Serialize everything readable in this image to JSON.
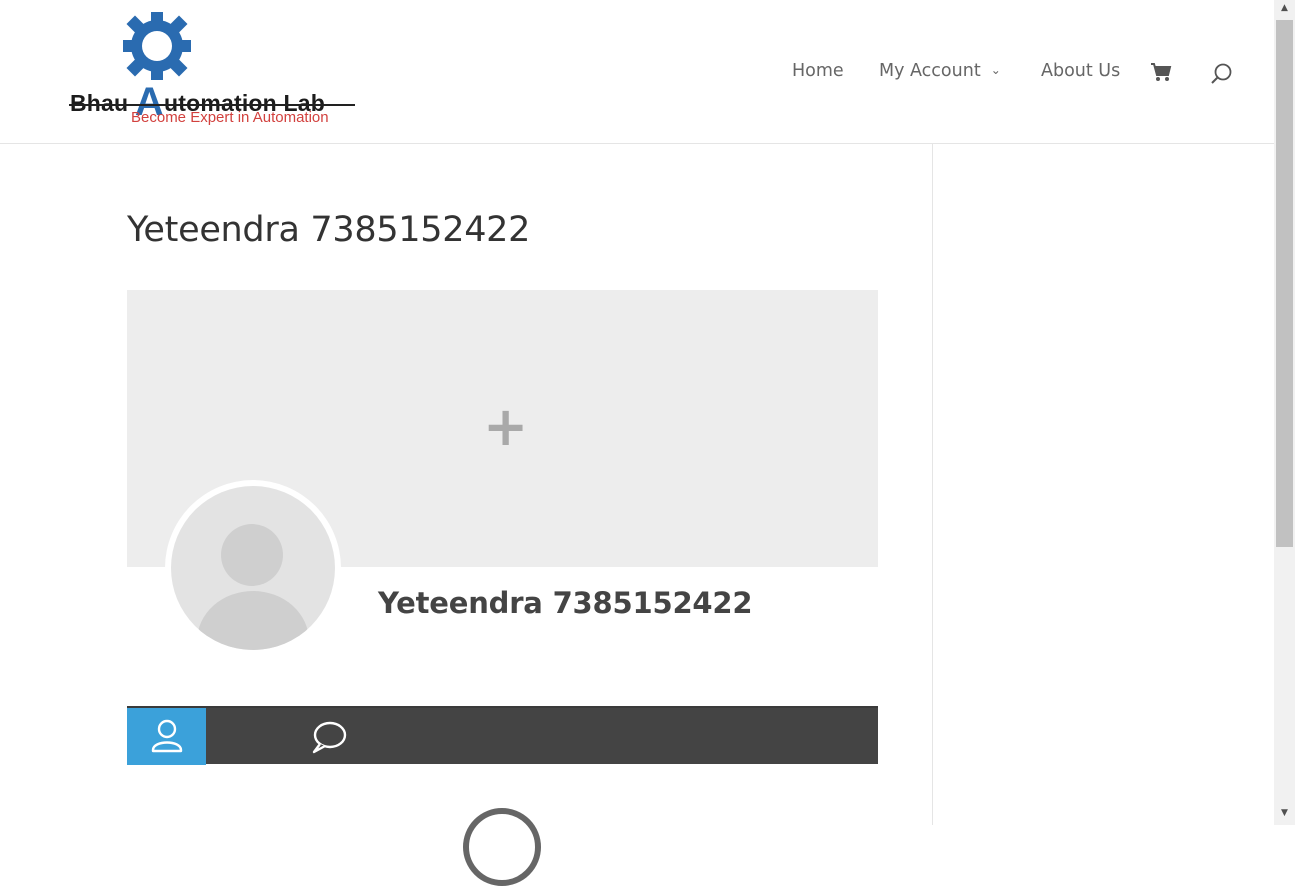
{
  "brand": {
    "name_prefix": "Bhau ",
    "name_a": "A",
    "name_suffix": "utomation Lab",
    "tagline": "Become Expert in Automation",
    "colors": {
      "gear": "#2a6bb0",
      "tagline": "#d2413e"
    }
  },
  "nav": {
    "items": [
      {
        "label": "Home"
      },
      {
        "label": "My Account"
      },
      {
        "label": "About Us"
      }
    ]
  },
  "page": {
    "title": "Yeteendra 7385152422"
  },
  "profile": {
    "name": "Yeteendra 7385152422",
    "cover_plus": "+"
  },
  "tabs": {
    "active_color": "#3ba1da",
    "bar_color": "#444444"
  },
  "icons": {
    "cart": "cart-icon",
    "search": "search-icon",
    "profile_tab": "user-icon",
    "comments_tab": "comment-icon"
  }
}
